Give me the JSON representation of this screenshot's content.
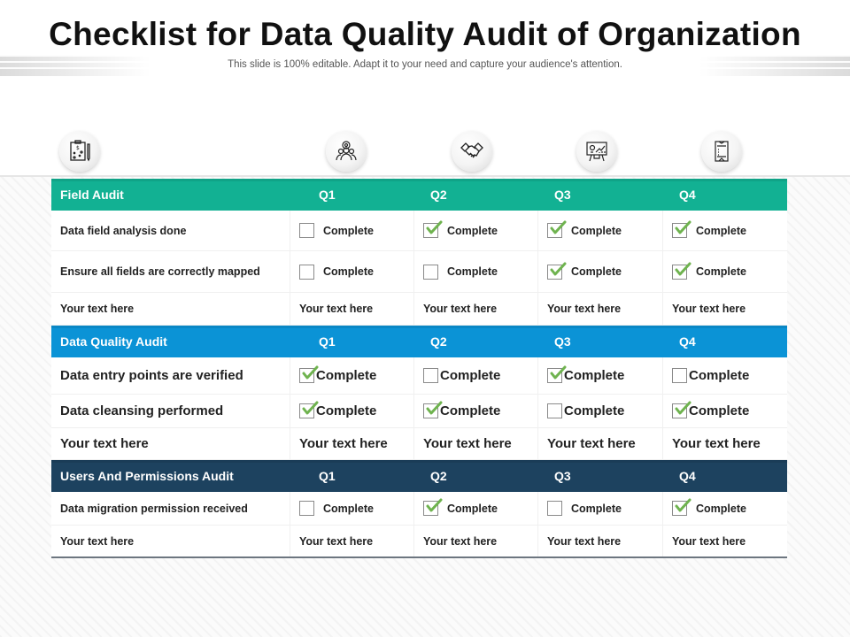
{
  "title": "Checklist for Data Quality Audit of Organization",
  "subtitle": "This slide is 100% editable. Adapt it to your need and capture your audience's attention.",
  "colors": {
    "field_audit": "#12b193",
    "data_quality_audit": "#0b93d6",
    "users_permissions_audit": "#1d425f",
    "check": "#6fb34f"
  },
  "icons": [
    "clipboard-strategy-icon",
    "team-gear-icon",
    "handshake-icon",
    "presentation-chart-icon",
    "document-list-icon"
  ],
  "sections": [
    {
      "title": "Field Audit",
      "quarters": [
        "Q1",
        "Q2",
        "Q3",
        "Q4"
      ],
      "rows": [
        {
          "label": "Data field analysis done",
          "cells": [
            {
              "checked": false,
              "text": "Complete"
            },
            {
              "checked": true,
              "text": "Complete"
            },
            {
              "checked": true,
              "text": "Complete"
            },
            {
              "checked": true,
              "text": "Complete"
            }
          ]
        },
        {
          "label": "Ensure all fields are correctly mapped",
          "cells": [
            {
              "checked": false,
              "text": "Complete"
            },
            {
              "checked": false,
              "text": "Complete"
            },
            {
              "checked": true,
              "text": "Complete"
            },
            {
              "checked": true,
              "text": "Complete"
            }
          ]
        },
        {
          "label": "Your text here",
          "texts": [
            "Your text here",
            "Your text here",
            "Your text here",
            "Your text here"
          ]
        }
      ]
    },
    {
      "title": "Data Quality Audit",
      "quarters": [
        "Q1",
        "Q2",
        "Q3",
        "Q4"
      ],
      "rows": [
        {
          "label": "Data entry points are verified",
          "cells": [
            {
              "checked": true,
              "text": "Complete"
            },
            {
              "checked": false,
              "text": "Complete"
            },
            {
              "checked": true,
              "text": "Complete"
            },
            {
              "checked": false,
              "text": "Complete"
            }
          ]
        },
        {
          "label": "Data cleansing performed",
          "cells": [
            {
              "checked": true,
              "text": "Complete"
            },
            {
              "checked": true,
              "text": "Complete"
            },
            {
              "checked": false,
              "text": "Complete"
            },
            {
              "checked": true,
              "text": "Complete"
            }
          ]
        },
        {
          "label": "Your text here",
          "texts": [
            "Your text here",
            "Your text here",
            "Your text here",
            "Your text here"
          ]
        }
      ]
    },
    {
      "title": "Users And Permissions Audit",
      "quarters": [
        "Q1",
        "Q2",
        "Q3",
        "Q4"
      ],
      "rows": [
        {
          "label": "Data migration permission received",
          "cells": [
            {
              "checked": false,
              "text": "Complete"
            },
            {
              "checked": true,
              "text": "Complete"
            },
            {
              "checked": false,
              "text": "Complete"
            },
            {
              "checked": true,
              "text": "Complete"
            }
          ]
        },
        {
          "label": "Your text here",
          "texts": [
            "Your text here",
            "Your text here",
            "Your text here",
            "Your text here"
          ]
        }
      ]
    }
  ]
}
